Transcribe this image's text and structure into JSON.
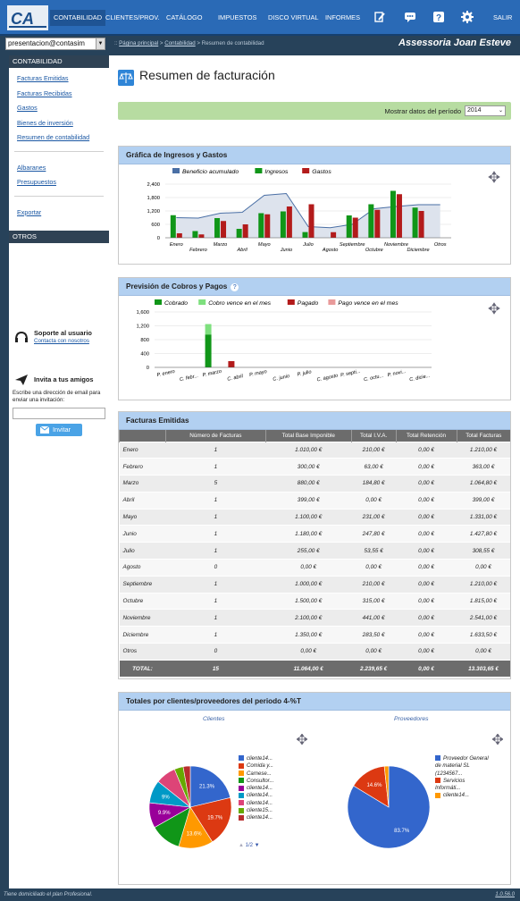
{
  "topnav": {
    "items": [
      {
        "label": "CONTABILIDAD"
      },
      {
        "label": "CLIENTES/PROV."
      },
      {
        "label": "CATÁLOGO"
      },
      {
        "label": "IMPUESTOS"
      },
      {
        "label": "DISCO VIRTUAL"
      },
      {
        "label": "INFORMES"
      }
    ],
    "exit": "SALIR"
  },
  "subbar": {
    "user": "presentacion@contasim",
    "breadcrumb": {
      "home": "Página principal",
      "section": "Contabilidad",
      "current": " > Resumen de contabilidad"
    },
    "brand": "Assessoria Joan Esteve"
  },
  "sidebar": {
    "contabilidad_header": "CONTABILIDAD",
    "links": [
      "Facturas Emitidas",
      "Facturas Recibidas",
      "Gastos",
      "Bienes de inversión",
      "Resumen de contabilidad"
    ],
    "links2": [
      "Albaranes",
      "Presupuestos"
    ],
    "export": "Exportar",
    "otros_header": "OTROS",
    "support_title": "Soporte al usuario",
    "support_link": "Contacta con nosotros",
    "invite_title": "Invita a tus amigos",
    "invite_text": "Escribe una dirección de email para enviar una invitación:",
    "invite_button": "Invitar"
  },
  "page": {
    "title": "Resumen de facturación",
    "period_label": "Mostrar datos del período",
    "period_value": "2014"
  },
  "chart1": {
    "title": "Gráfica de Ingresos y Gastos"
  },
  "chart2": {
    "title": "Previsión de Cobros y Pagos"
  },
  "table": {
    "title": "Facturas Emitidas",
    "headers": [
      "",
      "Número de Facturas",
      "Total Base Imponible",
      "Total I.V.A.",
      "Total Retención",
      "Total Facturas"
    ],
    "rows": [
      [
        "Enero",
        "1",
        "1.010,00 €",
        "210,00 €",
        "0,00 €",
        "1.210,00 €"
      ],
      [
        "Febrero",
        "1",
        "300,00 €",
        "63,00 €",
        "0,00 €",
        "363,00 €"
      ],
      [
        "Marzo",
        "5",
        "880,00 €",
        "184,80 €",
        "0,00 €",
        "1.064,80 €"
      ],
      [
        "Abril",
        "1",
        "399,00 €",
        "0,00 €",
        "0,00 €",
        "399,00 €"
      ],
      [
        "Mayo",
        "1",
        "1.100,00 €",
        "231,00 €",
        "0,00 €",
        "1.331,00 €"
      ],
      [
        "Junio",
        "1",
        "1.180,00 €",
        "247,80 €",
        "0,00 €",
        "1.427,80 €"
      ],
      [
        "Julio",
        "1",
        "255,00 €",
        "53,55 €",
        "0,00 €",
        "308,55 €"
      ],
      [
        "Agosto",
        "0",
        "0,00 €",
        "0,00 €",
        "0,00 €",
        "0,00 €"
      ],
      [
        "Septiembre",
        "1",
        "1.000,00 €",
        "210,00 €",
        "0,00 €",
        "1.210,00 €"
      ],
      [
        "Octubre",
        "1",
        "1.500,00 €",
        "315,00 €",
        "0,00 €",
        "1.815,00 €"
      ],
      [
        "Noviembre",
        "1",
        "2.100,00 €",
        "441,00 €",
        "0,00 €",
        "2.541,00 €"
      ],
      [
        "Diciembre",
        "1",
        "1.350,00 €",
        "283,50 €",
        "0,00 €",
        "1.633,50 €"
      ],
      [
        "Otros",
        "0",
        "0,00 €",
        "0,00 €",
        "0,00 €",
        "0,00 €"
      ]
    ],
    "total": [
      "TOTAL:",
      "15",
      "11.064,00 €",
      "2.239,65 €",
      "0,00 €",
      "13.303,65 €"
    ]
  },
  "totals": {
    "title": "Totales por clientes/proveedores del periodo 4-%T",
    "clientes_label": "Clientes",
    "proveedores_label": "Proveedores",
    "pager": "1/2"
  },
  "footer": {
    "left": "Tiene domiciliado el plan Profesional.",
    "right": "1.0.56.0"
  },
  "colors": {
    "blue": "#3366cc",
    "green": "#109618",
    "red": "#b31b1b",
    "lightgreen": "#7ee07e",
    "lightred": "#e89a9a",
    "lineblue": "#4a6fa5"
  },
  "chart_data": [
    {
      "type": "bar",
      "title": "Gráfica de Ingresos y Gastos",
      "categories": [
        "Enero",
        "Febrero",
        "Marzo",
        "Abril",
        "Mayo",
        "Junio",
        "Julio",
        "Agosto",
        "Septiembre",
        "Octubre",
        "Noviembre",
        "Diciembre",
        "Otros"
      ],
      "series": [
        {
          "name": "Beneficio acumulado",
          "type": "area",
          "values": [
            900,
            880,
            1100,
            1140,
            1900,
            1980,
            500,
            450,
            600,
            1300,
            1400,
            1480,
            1480
          ]
        },
        {
          "name": "Ingresos",
          "values": [
            1010,
            300,
            880,
            399,
            1100,
            1180,
            255,
            0,
            1000,
            1500,
            2100,
            1350,
            0
          ]
        },
        {
          "name": "Gastos",
          "values": [
            200,
            150,
            750,
            600,
            1050,
            1400,
            1500,
            250,
            900,
            1250,
            1950,
            1200,
            0
          ]
        }
      ],
      "ylim": [
        0,
        2400
      ],
      "yticks": [
        "0",
        "600",
        "1,200",
        "1,800",
        "2,400"
      ],
      "legend": "top"
    },
    {
      "type": "bar",
      "title": "Previsión de Cobros y Pagos",
      "categories": [
        "P. enero",
        "C. febr...",
        "P. marzo",
        "C. abril",
        "P. mayo",
        "C. junio",
        "P. julio",
        "C. agosto",
        "P. septi...",
        "C. octu...",
        "P. novi...",
        "C. dicie..."
      ],
      "series": [
        {
          "name": "Cobrado",
          "values": [
            0,
            0,
            950,
            0,
            0,
            0,
            0,
            0,
            0,
            0,
            0,
            0
          ]
        },
        {
          "name": "Cobro vence en el mes",
          "values": [
            0,
            0,
            300,
            0,
            0,
            0,
            0,
            0,
            0,
            0,
            0,
            0
          ]
        },
        {
          "name": "Pagado",
          "values": [
            0,
            0,
            0,
            180,
            0,
            0,
            0,
            0,
            0,
            0,
            0,
            0
          ]
        },
        {
          "name": "Pago vence en el mes",
          "values": [
            0,
            0,
            0,
            0,
            0,
            0,
            0,
            0,
            0,
            0,
            0,
            0
          ]
        }
      ],
      "ylim": [
        0,
        1600
      ],
      "yticks": [
        "0",
        "400",
        "800",
        "1,200",
        "1,600"
      ],
      "legend": "top"
    },
    {
      "type": "pie",
      "title": "Clientes",
      "labels": [
        "cliente14...",
        "Comida y...",
        "Carnese...",
        "Consultor...",
        "cliente14...",
        "cliente14...",
        "cliente14...",
        "cliente15...",
        "cliente14..."
      ],
      "values": [
        21.3,
        19.7,
        13.6,
        12.2,
        9.9,
        9,
        8,
        3.5,
        2.8
      ],
      "colors": [
        "#3366cc",
        "#dc3912",
        "#ff9900",
        "#109618",
        "#990099",
        "#0099c6",
        "#dd4477",
        "#66aa00",
        "#b82e2e"
      ]
    },
    {
      "type": "pie",
      "title": "Proveedores",
      "labels": [
        "Proveedor General de material SL (1234567...",
        "Servicios Informáti...",
        "cliente14..."
      ],
      "values": [
        83.7,
        14.6,
        1.7
      ],
      "colors": [
        "#3366cc",
        "#dc3912",
        "#ff9900"
      ]
    }
  ]
}
